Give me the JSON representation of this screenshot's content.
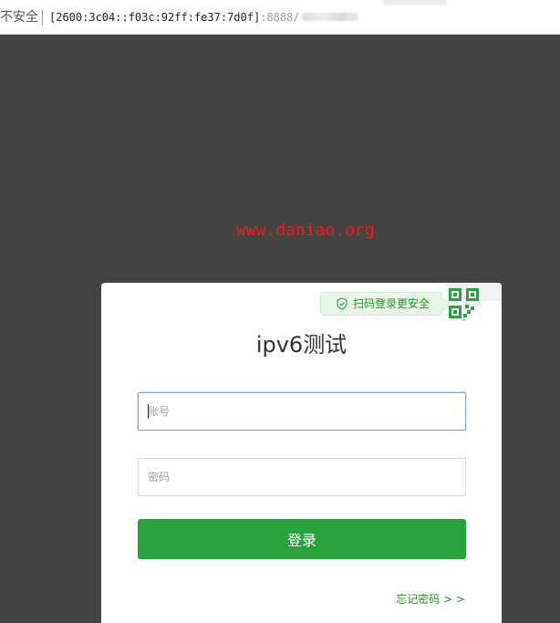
{
  "address_bar": {
    "security_label": "不安全",
    "url_host": "[2600:3c04::f03c:92ff:fe37:7d0f]",
    "url_port": ":8888/"
  },
  "watermark": "www.daniao.org",
  "login": {
    "qr_hint": "扫码登录更安全",
    "title": "ipv6测试",
    "account_placeholder": "账号",
    "password_placeholder": "密码",
    "submit_label": "登录",
    "forgot_password": "忘记密码 > >"
  },
  "colors": {
    "background": "#444444",
    "accent_green": "#2aa33e",
    "watermark_red": "#ee1c1c",
    "focus_border": "#7fa6d6"
  },
  "icons": {
    "qr_hint_icon": "shield-check-icon",
    "corner_icon": "qr-code-icon"
  }
}
